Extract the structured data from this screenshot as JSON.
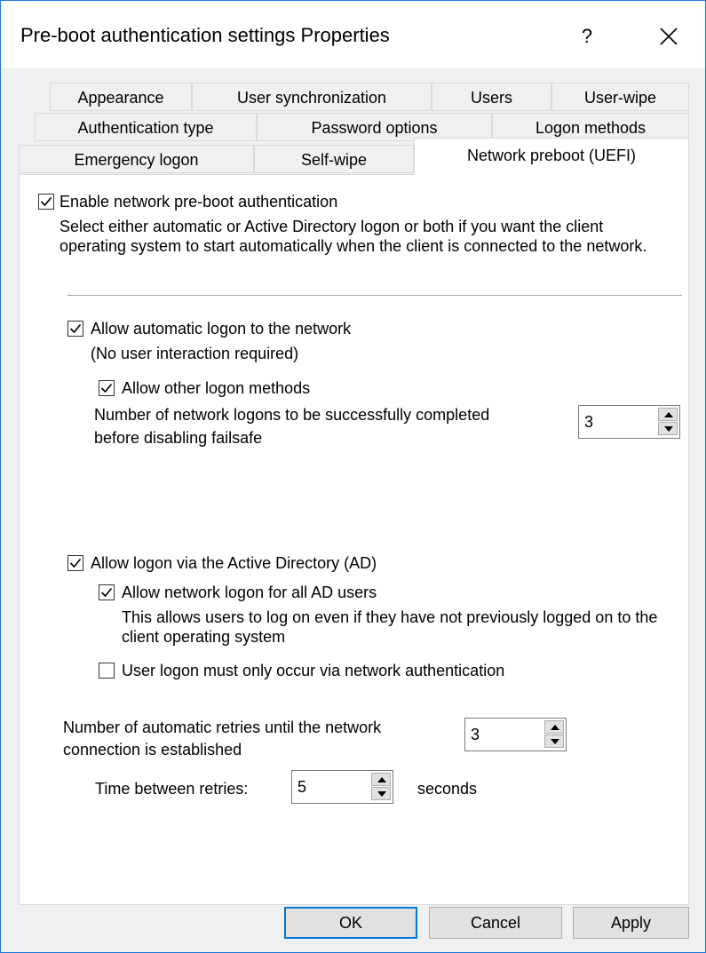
{
  "window": {
    "title": "Pre-boot authentication settings Properties",
    "help": "?"
  },
  "tabs": {
    "row1": [
      "Appearance",
      "User synchronization",
      "Users",
      "User-wipe"
    ],
    "row2": [
      "Authentication type",
      "Password options",
      "Logon methods"
    ],
    "row3": [
      "Emergency logon",
      "Self-wipe",
      "Network preboot (UEFI)"
    ]
  },
  "enable_network": {
    "label": "Enable network pre-boot authentication",
    "checked": true,
    "description": "Select either automatic or Active Directory logon or both if you want the client operating system to start automatically when the client is connected to the network."
  },
  "auto_logon": {
    "label": "Allow automatic logon to the network",
    "checked": true,
    "note": "(No user interaction required)",
    "other_methods": {
      "label": "Allow other logon methods",
      "checked": true
    },
    "failsafe": {
      "label_line1": "Number of network logons to be successfully completed",
      "label_line2": "before disabling failsafe",
      "value": "3"
    }
  },
  "ad_logon": {
    "label": "Allow logon via the Active Directory (AD)",
    "checked": true,
    "all_users": {
      "label": "Allow network logon for all AD users",
      "checked": true,
      "description": "This allows users to log on even if they have not previously logged on to the client operating system"
    },
    "only_network": {
      "label": "User logon must only occur via network authentication",
      "checked": false
    }
  },
  "retries": {
    "label_line1": "Number of automatic retries until the network",
    "label_line2": "connection is established",
    "value": "3"
  },
  "time_between": {
    "label": "Time between retries:",
    "value": "5",
    "unit": "seconds"
  },
  "buttons": {
    "ok": "OK",
    "cancel": "Cancel",
    "apply": "Apply"
  }
}
